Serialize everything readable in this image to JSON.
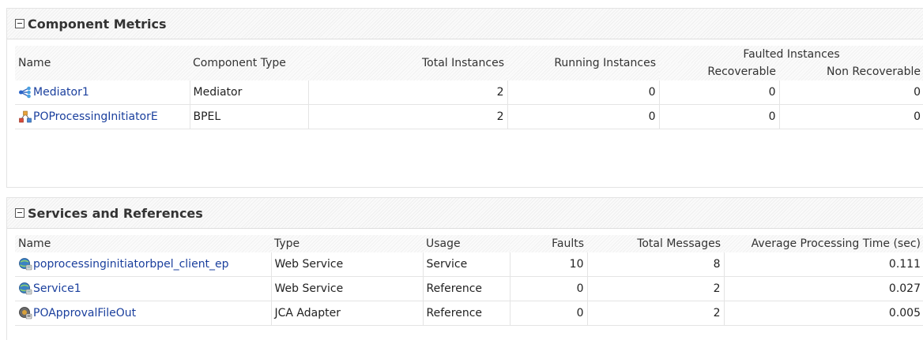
{
  "component_metrics": {
    "title": "Component Metrics",
    "headers": {
      "name": "Name",
      "component_type": "Component Type",
      "total_instances": "Total Instances",
      "running_instances": "Running Instances",
      "faulted_instances": "Faulted Instances",
      "recoverable": "Recoverable",
      "non_recoverable": "Non Recoverable"
    },
    "rows": [
      {
        "name": "Mediator1",
        "icon": "mediator-icon",
        "type": "Mediator",
        "total": "2",
        "running": "0",
        "recoverable": "0",
        "non_recoverable": "0"
      },
      {
        "name": "POProcessingInitiatorE",
        "icon": "bpel-icon",
        "type": "BPEL",
        "total": "2",
        "running": "0",
        "recoverable": "0",
        "non_recoverable": "0"
      }
    ]
  },
  "services_references": {
    "title": "Services and References",
    "headers": {
      "name": "Name",
      "type": "Type",
      "usage": "Usage",
      "faults": "Faults",
      "total_messages": "Total Messages",
      "avg_time": "Average Processing Time (sec)"
    },
    "rows": [
      {
        "name": "poprocessinginitiatorbpel_client_ep",
        "icon": "web-service-icon",
        "type": "Web Service",
        "usage": "Service",
        "faults": "10",
        "total_messages": "8",
        "avg_time": "0.111"
      },
      {
        "name": "Service1",
        "icon": "web-service-icon",
        "type": "Web Service",
        "usage": "Reference",
        "faults": "0",
        "total_messages": "2",
        "avg_time": "0.027"
      },
      {
        "name": "POApprovalFileOut",
        "icon": "jca-adapter-icon",
        "type": "JCA Adapter",
        "usage": "Reference",
        "faults": "0",
        "total_messages": "2",
        "avg_time": "0.005"
      }
    ]
  },
  "colors": {
    "link": "#1a3f9d",
    "header_bg": "#f1f1f1"
  }
}
